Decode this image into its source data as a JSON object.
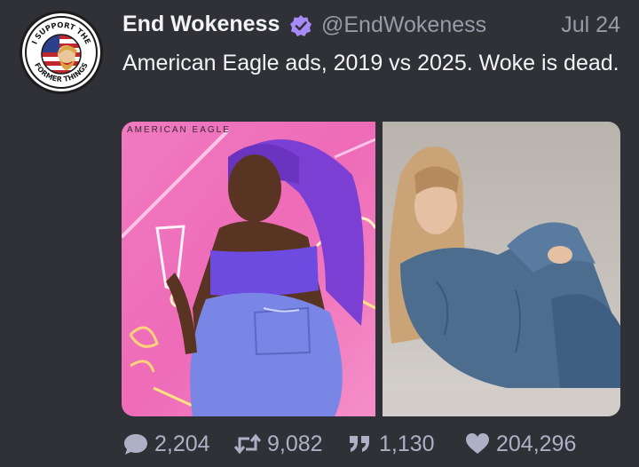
{
  "tweet": {
    "display_name": "End Wokeness",
    "handle": "@EndWokeness",
    "date": "Jul 24",
    "text": "American Eagle ads, 2019 vs 2025. Woke is dead.",
    "avatar_text_top": "I SUPPORT THE",
    "avatar_text_bottom": "FORMER THINGS"
  },
  "media": {
    "left_brand_text": "AMERICAN EAGLE"
  },
  "stats": {
    "replies": "2,204",
    "retweets": "9,082",
    "quotes": "1,130",
    "likes": "204,296"
  },
  "colors": {
    "background": "#2f3136",
    "verified": "#a78bfa",
    "muted": "#9a9aa8",
    "action": "#aeb0c6"
  },
  "icons": {
    "verified": "verified-badge-icon",
    "reply": "speech-bubble-icon",
    "retweet": "retweet-arrows-icon",
    "quote": "quote-marks-icon",
    "like": "heart-icon"
  }
}
